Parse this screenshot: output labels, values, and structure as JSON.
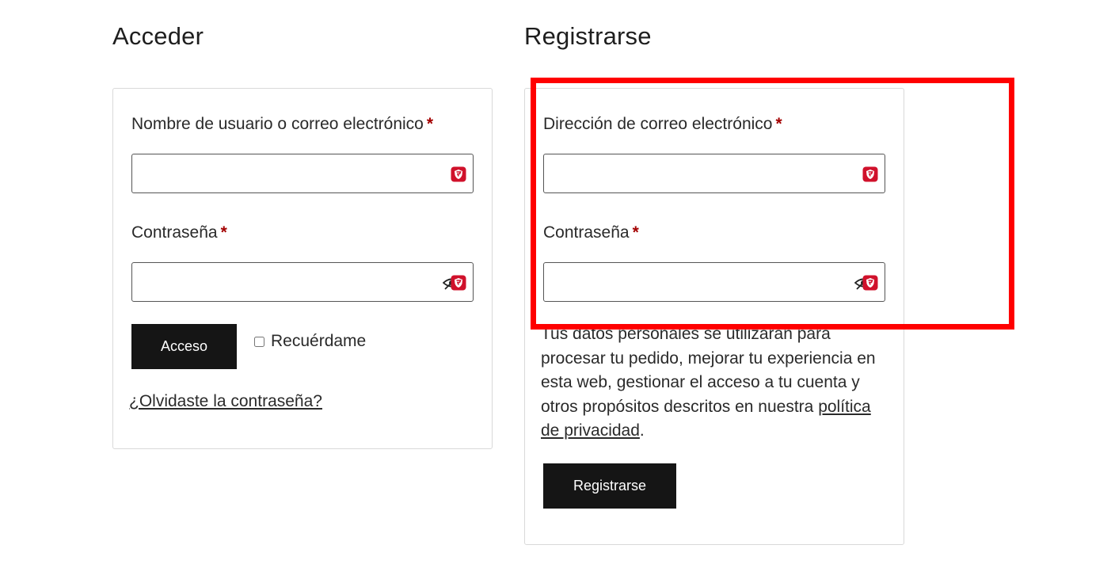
{
  "login": {
    "title": "Acceder",
    "username_label": "Nombre de usuario o correo electrónico",
    "required_mark": "*",
    "username_value": "",
    "password_label": "Contraseña",
    "password_value": "",
    "submit_label": "Acceso",
    "remember_label": "Recuérdame",
    "remember_checked": false,
    "lost_password_label": "¿Olvidaste la contraseña?"
  },
  "register": {
    "title": "Registrarse",
    "email_label": "Dirección de correo electrónico",
    "required_mark": "*",
    "email_value": "",
    "password_label": "Contraseña",
    "password_value": "",
    "privacy_text": "Tus datos personales se utilizarán para procesar tu pedido, mejorar tu experiencia en esta web, gestionar el acceso a tu cuenta y otros propósitos descritos en nuestra",
    "privacy_link_label": "política de privacidad",
    "privacy_end": ".",
    "submit_label": "Registrarse"
  },
  "colors": {
    "required": "#a30000",
    "button_bg": "#151515",
    "highlight": "#ff0000",
    "extension_icon": "#d0112b"
  },
  "icons": {
    "field_extension": "shield-extension-icon",
    "password_toggle": "eye-slash-icon"
  }
}
